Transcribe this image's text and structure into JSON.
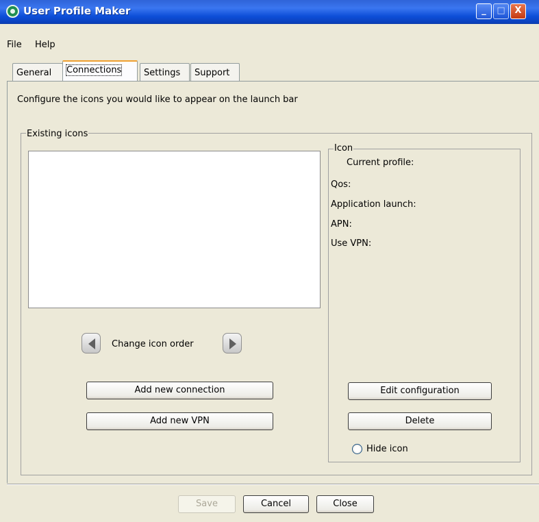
{
  "window": {
    "title": "User Profile Maker",
    "icons": {
      "app": "app-icon",
      "minimize": "minimize-icon",
      "maximize": "maximize-icon",
      "close": "close-icon"
    },
    "minimize_glyph": "_",
    "maximize_glyph": "□",
    "close_glyph": "X"
  },
  "menu": {
    "file": "File",
    "help": "Help"
  },
  "tabs": [
    {
      "label": "General"
    },
    {
      "label": "Connections",
      "selected": true
    },
    {
      "label": "Settings"
    },
    {
      "label": "Support"
    }
  ],
  "instruction": "Configure the icons you would like to appear on the launch bar",
  "existing_icons": {
    "title": "Existing icons",
    "order_label": "Change icon order",
    "add_connection": "Add new connection",
    "add_vpn": "Add new VPN"
  },
  "icon_panel": {
    "title": "Icon",
    "current_profile": "Current profile:",
    "qos": "Qos:",
    "application_launch": "Application launch:",
    "apn": "APN:",
    "use_vpn": "Use VPN:",
    "edit": "Edit configuration",
    "delete": "Delete",
    "hide_icon": "Hide icon",
    "hide_icon_checked": false
  },
  "footer": {
    "save": "Save",
    "cancel": "Cancel",
    "close": "Close"
  },
  "colors": {
    "titlebar": "#2f63d8",
    "window_bg": "#ece9d8",
    "active_tab_accent": "#f0a030",
    "close_button": "#c43a12"
  }
}
